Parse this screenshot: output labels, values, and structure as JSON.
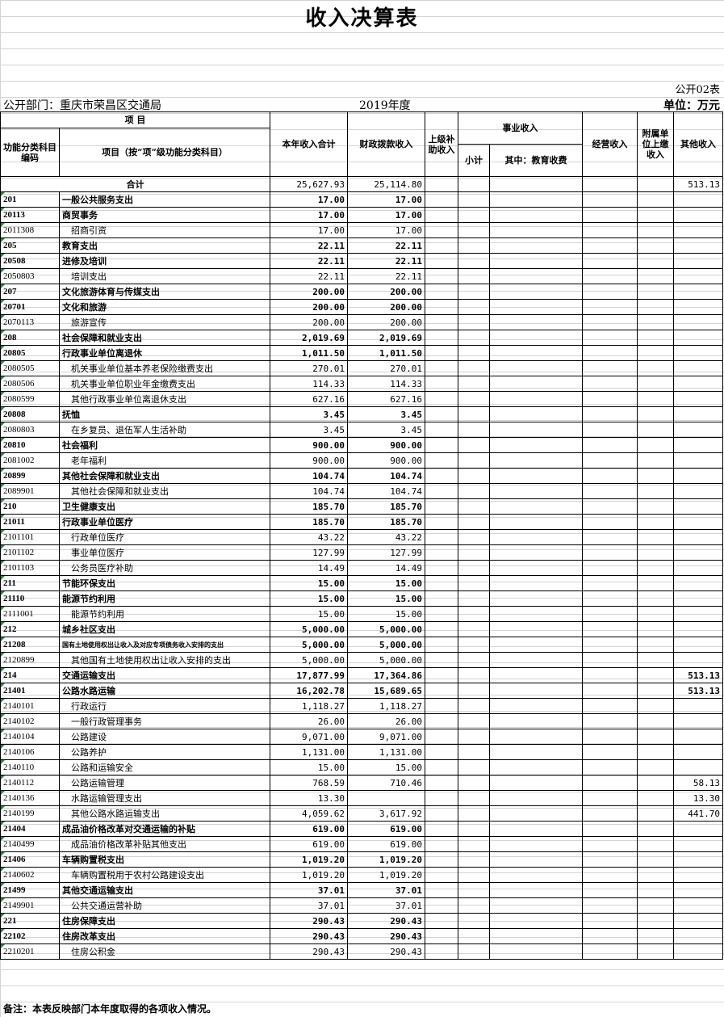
{
  "title": "收入决算表",
  "form_no": "公开02表",
  "dept_label": "公开部门：重庆市荣昌区交通局",
  "year": "2019年度",
  "unit": "单位：万元",
  "headers": {
    "item": "项 目",
    "code": "功能分类科目编码",
    "name": "项目（按“项”级功能分类科目）",
    "total": "本年收入合计",
    "fiscal": "财政拨款收入",
    "superior": "上级补助收入",
    "business": "事业收入",
    "subtotal": "小计",
    "edu": "其中：教育收费",
    "operation": "经营收入",
    "affiliated": "附属单位上缴收入",
    "other": "其他收入"
  },
  "total_row": {
    "label": "合计",
    "total": "25,627.93",
    "fiscal": "25,114.80",
    "other": "513.13"
  },
  "rows": [
    {
      "code": "201",
      "name": "一般公共服务支出",
      "total": "17.00",
      "fiscal": "17.00",
      "other": "",
      "bold": true
    },
    {
      "code": "20113",
      "name": "商贸事务",
      "total": "17.00",
      "fiscal": "17.00",
      "other": "",
      "bold": true
    },
    {
      "code": "2011308",
      "name": "招商引资",
      "total": "17.00",
      "fiscal": "17.00",
      "other": "",
      "bold": false
    },
    {
      "code": "205",
      "name": "教育支出",
      "total": "22.11",
      "fiscal": "22.11",
      "other": "",
      "bold": true
    },
    {
      "code": "20508",
      "name": "进修及培训",
      "total": "22.11",
      "fiscal": "22.11",
      "other": "",
      "bold": true
    },
    {
      "code": "2050803",
      "name": "培训支出",
      "total": "22.11",
      "fiscal": "22.11",
      "other": "",
      "bold": false
    },
    {
      "code": "207",
      "name": "文化旅游体育与传媒支出",
      "total": "200.00",
      "fiscal": "200.00",
      "other": "",
      "bold": true
    },
    {
      "code": "20701",
      "name": "文化和旅游",
      "total": "200.00",
      "fiscal": "200.00",
      "other": "",
      "bold": true
    },
    {
      "code": "2070113",
      "name": "旅游宣传",
      "total": "200.00",
      "fiscal": "200.00",
      "other": "",
      "bold": false
    },
    {
      "code": "208",
      "name": "社会保障和就业支出",
      "total": "2,019.69",
      "fiscal": "2,019.69",
      "other": "",
      "bold": true
    },
    {
      "code": "20805",
      "name": "行政事业单位离退休",
      "total": "1,011.50",
      "fiscal": "1,011.50",
      "other": "",
      "bold": true
    },
    {
      "code": "2080505",
      "name": "机关事业单位基本养老保险缴费支出",
      "total": "270.01",
      "fiscal": "270.01",
      "other": "",
      "bold": false
    },
    {
      "code": "2080506",
      "name": "机关事业单位职业年金缴费支出",
      "total": "114.33",
      "fiscal": "114.33",
      "other": "",
      "bold": false
    },
    {
      "code": "2080599",
      "name": "其他行政事业单位离退休支出",
      "total": "627.16",
      "fiscal": "627.16",
      "other": "",
      "bold": false
    },
    {
      "code": "20808",
      "name": "抚恤",
      "total": "3.45",
      "fiscal": "3.45",
      "other": "",
      "bold": true
    },
    {
      "code": "2080803",
      "name": "在乡复员、退伍军人生活补助",
      "total": "3.45",
      "fiscal": "3.45",
      "other": "",
      "bold": false
    },
    {
      "code": "20810",
      "name": "社会福利",
      "total": "900.00",
      "fiscal": "900.00",
      "other": "",
      "bold": true
    },
    {
      "code": "2081002",
      "name": "老年福利",
      "total": "900.00",
      "fiscal": "900.00",
      "other": "",
      "bold": false
    },
    {
      "code": "20899",
      "name": "其他社会保障和就业支出",
      "total": "104.74",
      "fiscal": "104.74",
      "other": "",
      "bold": true
    },
    {
      "code": "2089901",
      "name": "其他社会保障和就业支出",
      "total": "104.74",
      "fiscal": "104.74",
      "other": "",
      "bold": false
    },
    {
      "code": "210",
      "name": "卫生健康支出",
      "total": "185.70",
      "fiscal": "185.70",
      "other": "",
      "bold": true
    },
    {
      "code": "21011",
      "name": "行政事业单位医疗",
      "total": "185.70",
      "fiscal": "185.70",
      "other": "",
      "bold": true
    },
    {
      "code": "2101101",
      "name": "行政单位医疗",
      "total": "43.22",
      "fiscal": "43.22",
      "other": "",
      "bold": false
    },
    {
      "code": "2101102",
      "name": "事业单位医疗",
      "total": "127.99",
      "fiscal": "127.99",
      "other": "",
      "bold": false
    },
    {
      "code": "2101103",
      "name": "公务员医疗补助",
      "total": "14.49",
      "fiscal": "14.49",
      "other": "",
      "bold": false
    },
    {
      "code": "211",
      "name": "节能环保支出",
      "total": "15.00",
      "fiscal": "15.00",
      "other": "",
      "bold": true
    },
    {
      "code": "21110",
      "name": "能源节约利用",
      "total": "15.00",
      "fiscal": "15.00",
      "other": "",
      "bold": true
    },
    {
      "code": "2111001",
      "name": "能源节约利用",
      "total": "15.00",
      "fiscal": "15.00",
      "other": "",
      "bold": false
    },
    {
      "code": "212",
      "name": "城乡社区支出",
      "total": "5,000.00",
      "fiscal": "5,000.00",
      "other": "",
      "bold": true
    },
    {
      "code": "21208",
      "name": "国有土地使用权出让收入及对应专项债务收入安排的支出",
      "total": "5,000.00",
      "fiscal": "5,000.00",
      "other": "",
      "bold": true,
      "small": true
    },
    {
      "code": "2120899",
      "name": "其他国有土地使用权出让收入安排的支出",
      "total": "5,000.00",
      "fiscal": "5,000.00",
      "other": "",
      "bold": false
    },
    {
      "code": "214",
      "name": "交通运输支出",
      "total": "17,877.99",
      "fiscal": "17,364.86",
      "other": "513.13",
      "bold": true
    },
    {
      "code": "21401",
      "name": "公路水路运输",
      "total": "16,202.78",
      "fiscal": "15,689.65",
      "other": "513.13",
      "bold": true
    },
    {
      "code": "2140101",
      "name": "行政运行",
      "total": "1,118.27",
      "fiscal": "1,118.27",
      "other": "",
      "bold": false
    },
    {
      "code": "2140102",
      "name": "一般行政管理事务",
      "total": "26.00",
      "fiscal": "26.00",
      "other": "",
      "bold": false
    },
    {
      "code": "2140104",
      "name": "公路建设",
      "total": "9,071.00",
      "fiscal": "9,071.00",
      "other": "",
      "bold": false
    },
    {
      "code": "2140106",
      "name": "公路养护",
      "total": "1,131.00",
      "fiscal": "1,131.00",
      "other": "",
      "bold": false
    },
    {
      "code": "2140110",
      "name": "公路和运输安全",
      "total": "15.00",
      "fiscal": "15.00",
      "other": "",
      "bold": false
    },
    {
      "code": "2140112",
      "name": "公路运输管理",
      "total": "768.59",
      "fiscal": "710.46",
      "other": "58.13",
      "bold": false
    },
    {
      "code": "2140136",
      "name": "水路运输管理支出",
      "total": "13.30",
      "fiscal": "",
      "other": "13.30",
      "bold": false
    },
    {
      "code": "2140199",
      "name": "其他公路水路运输支出",
      "total": "4,059.62",
      "fiscal": "3,617.92",
      "other": "441.70",
      "bold": false
    },
    {
      "code": "21404",
      "name": "成品油价格改革对交通运输的补贴",
      "total": "619.00",
      "fiscal": "619.00",
      "other": "",
      "bold": true
    },
    {
      "code": "2140499",
      "name": "成品油价格改革补贴其他支出",
      "total": "619.00",
      "fiscal": "619.00",
      "other": "",
      "bold": false
    },
    {
      "code": "21406",
      "name": "车辆购置税支出",
      "total": "1,019.20",
      "fiscal": "1,019.20",
      "other": "",
      "bold": true
    },
    {
      "code": "2140602",
      "name": "车辆购置税用于农村公路建设支出",
      "total": "1,019.20",
      "fiscal": "1,019.20",
      "other": "",
      "bold": false
    },
    {
      "code": "21499",
      "name": "其他交通运输支出",
      "total": "37.01",
      "fiscal": "37.01",
      "other": "",
      "bold": true
    },
    {
      "code": "2149901",
      "name": "公共交通运营补助",
      "total": "37.01",
      "fiscal": "37.01",
      "other": "",
      "bold": false
    },
    {
      "code": "221",
      "name": "住房保障支出",
      "total": "290.43",
      "fiscal": "290.43",
      "other": "",
      "bold": true
    },
    {
      "code": "22102",
      "name": "住房改革支出",
      "total": "290.43",
      "fiscal": "290.43",
      "other": "",
      "bold": true
    },
    {
      "code": "2210201",
      "name": "住房公积金",
      "total": "290.43",
      "fiscal": "290.43",
      "other": "",
      "bold": false
    }
  ],
  "footer": "备注：本表反映部门本年度取得的各项收入情况。"
}
